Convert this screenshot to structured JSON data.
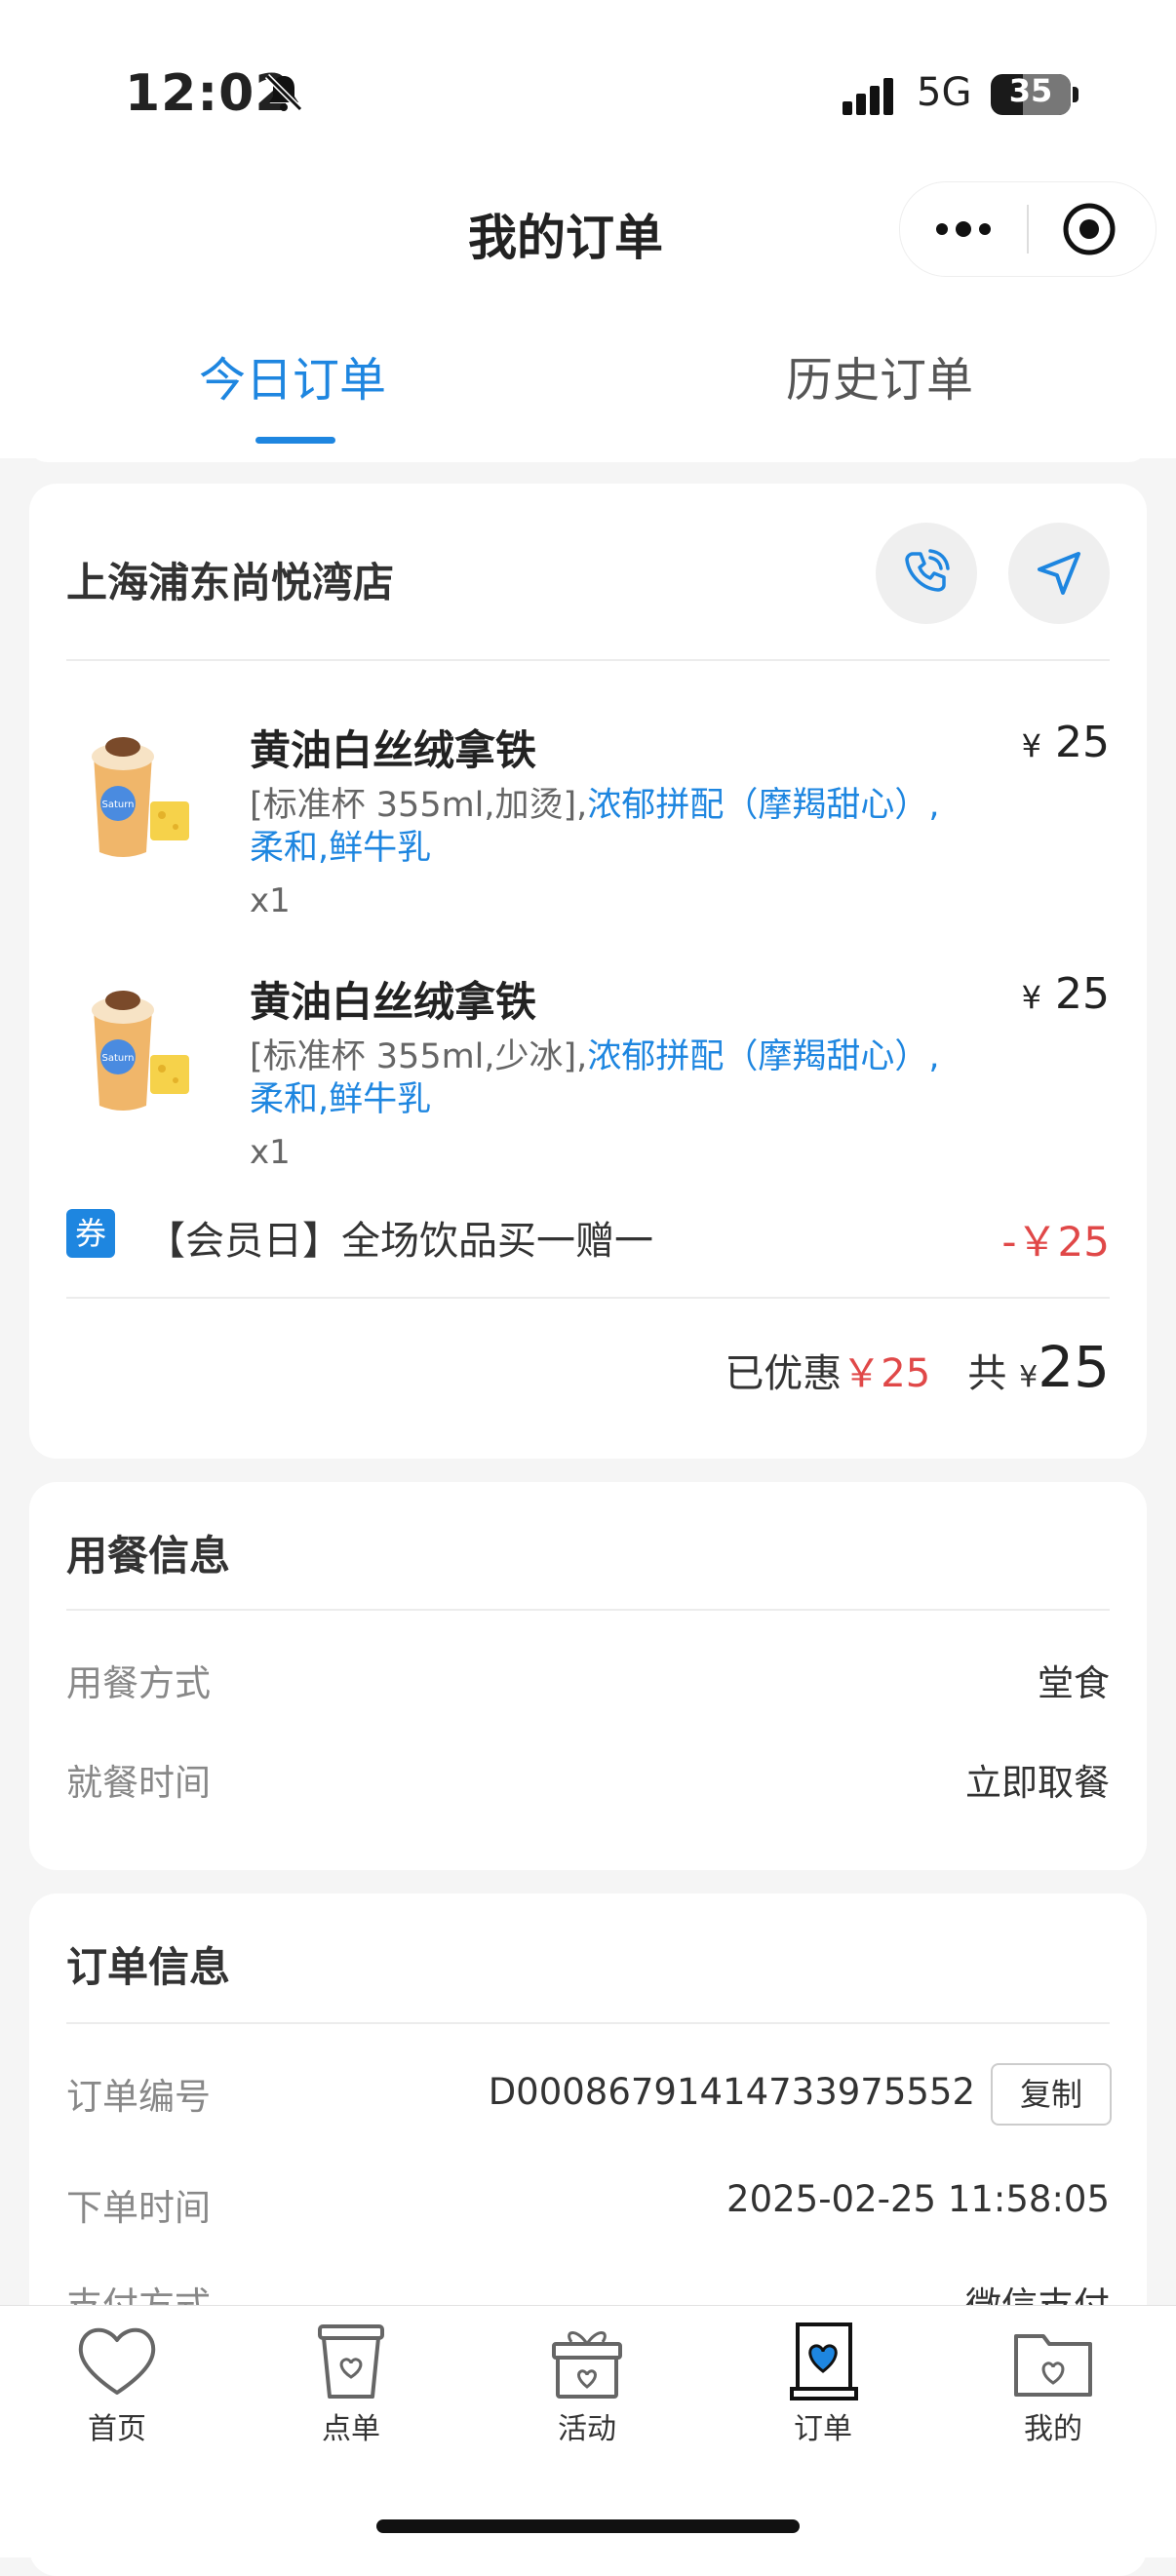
{
  "status_bar": {
    "time": "12:02",
    "network": "5G",
    "battery": "35"
  },
  "nav": {
    "title": "我的订单"
  },
  "tabs": [
    {
      "label": "今日订单",
      "active": true
    },
    {
      "label": "历史订单",
      "active": false
    }
  ],
  "order": {
    "store_name": "上海浦东尚悦湾店",
    "items": [
      {
        "name": "黄油白丝绒拿铁",
        "spec_plain": "[标准杯 355ml,加烫],",
        "spec_highlight_1": "浓郁拼配（摩羯甜心）,",
        "spec_highlight_2": "柔和,鲜牛乳",
        "qty": "x1",
        "price_symbol": "¥",
        "price": "25"
      },
      {
        "name": "黄油白丝绒拿铁",
        "spec_plain": "[标准杯 355ml,少冰],",
        "spec_highlight_1": "浓郁拼配（摩羯甜心）,",
        "spec_highlight_2": "柔和,鲜牛乳",
        "qty": "x1",
        "price_symbol": "¥",
        "price": "25"
      }
    ],
    "coupon": {
      "badge": "券",
      "text": "【会员日】全场饮品买一赠一",
      "amount": "-￥25"
    },
    "summary": {
      "discount_label": "已优惠",
      "discount_value": "￥25",
      "total_label": "共",
      "total_symbol": "¥",
      "total_value": "25"
    }
  },
  "dining": {
    "title": "用餐信息",
    "rows": [
      {
        "label": "用餐方式",
        "value": "堂食"
      },
      {
        "label": "就餐时间",
        "value": "立即取餐"
      }
    ]
  },
  "order_info": {
    "title": "订单信息",
    "order_no_label": "订单编号",
    "order_no": "D00086791414733975552",
    "copy_label": "复制",
    "time_label": "下单时间",
    "time_value": "2025-02-25 11:58:05",
    "pay_label": "支付方式",
    "pay_value": "微信支付"
  },
  "tabbar": [
    {
      "label": "首页",
      "icon": "heart-icon",
      "active": false
    },
    {
      "label": "点单",
      "icon": "cup-icon",
      "active": false
    },
    {
      "label": "活动",
      "icon": "gift-icon",
      "active": false
    },
    {
      "label": "订单",
      "icon": "order-icon",
      "active": true
    },
    {
      "label": "我的",
      "icon": "profile-icon",
      "active": false
    }
  ],
  "colors": {
    "accent": "#1e86e0",
    "discount": "#e04848"
  }
}
